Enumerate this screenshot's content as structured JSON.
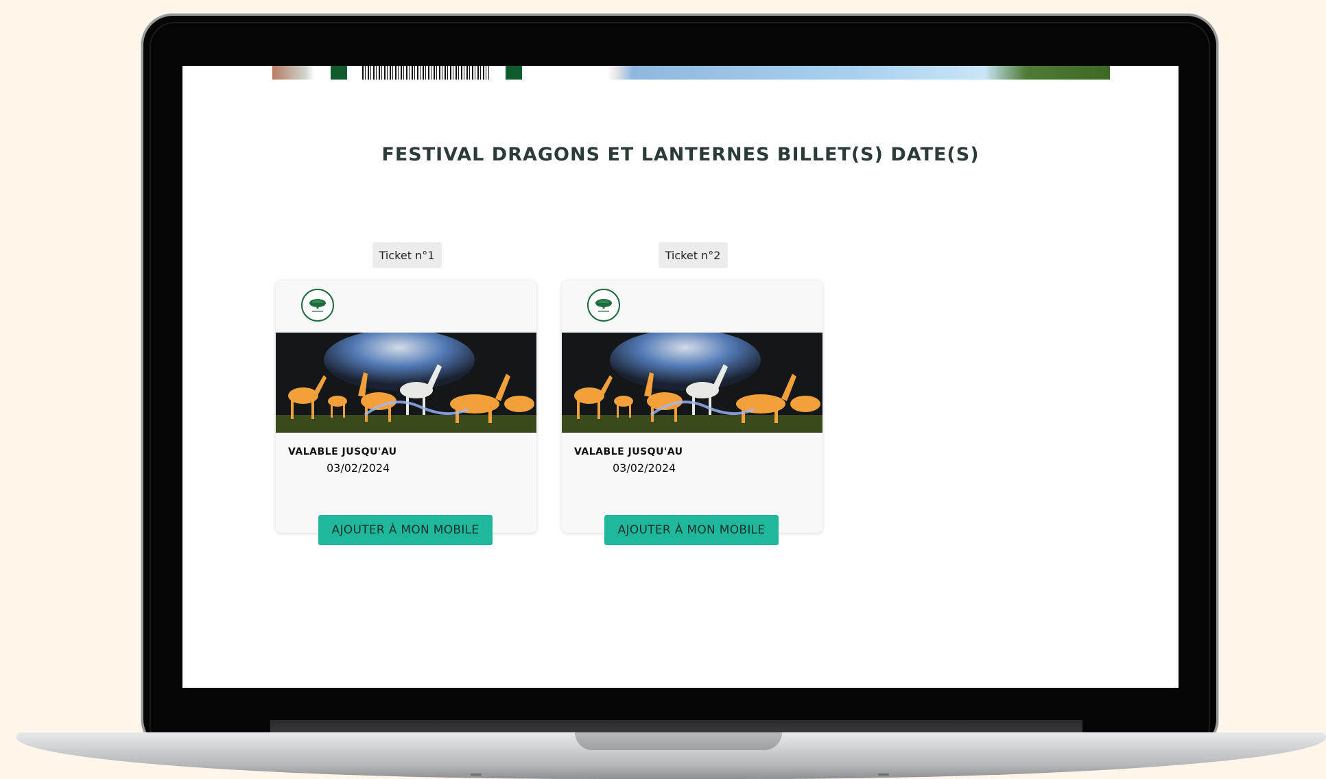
{
  "page": {
    "title": "FESTIVAL DRAGONS ET LANTERNES BILLET(S) DATE(S)"
  },
  "tickets": [
    {
      "label": "Ticket n°1",
      "valid_label": "VALABLE JUSQU'AU",
      "valid_date": "03/02/2024",
      "button_label": "AJOUTER À MON MOBILE"
    },
    {
      "label": "Ticket n°2",
      "valid_label": "VALABLE JUSQU'AU",
      "valid_date": "03/02/2024",
      "button_label": "AJOUTER À MON MOBILE"
    }
  ],
  "colors": {
    "accent_button": "#20b89c",
    "logo_green": "#1e6b3c",
    "page_background": "#fdf6e9"
  },
  "icons": [
    "park-logo-icon",
    "illuminated-deer-photo"
  ]
}
